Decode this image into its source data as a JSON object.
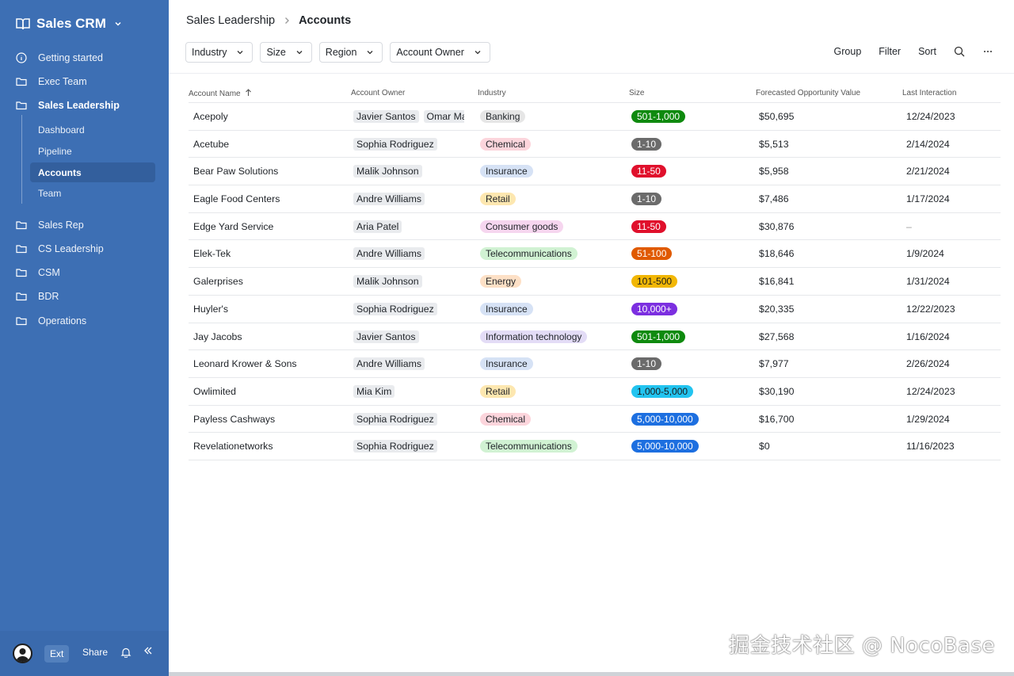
{
  "sidebar": {
    "app_title": "Sales CRM",
    "items": [
      {
        "label": "Getting started"
      },
      {
        "label": "Exec Team"
      },
      {
        "label": "Sales Leadership"
      },
      {
        "label": "Sales Rep"
      },
      {
        "label": "CS Leadership"
      },
      {
        "label": "CSM"
      },
      {
        "label": "BDR"
      },
      {
        "label": "Operations"
      }
    ],
    "sub_items": [
      {
        "label": "Dashboard"
      },
      {
        "label": "Pipeline"
      },
      {
        "label": "Accounts"
      },
      {
        "label": "Team"
      }
    ],
    "bottom": {
      "ext_label": "Ext",
      "share_label": "Share"
    }
  },
  "header": {
    "breadcrumb_parent": "Sales Leadership",
    "breadcrumb_current": "Accounts",
    "filters": [
      {
        "label": "Industry"
      },
      {
        "label": "Size"
      },
      {
        "label": "Region"
      },
      {
        "label": "Account Owner"
      }
    ],
    "toolbar": {
      "group": "Group",
      "filter": "Filter",
      "sort": "Sort"
    }
  },
  "table": {
    "columns": [
      "Account Name",
      "Account Owner",
      "Industry",
      "Size",
      "Forecasted Opportunity Value",
      "Last Interaction"
    ],
    "rows": [
      {
        "name": "Acepoly",
        "owners": [
          "Javier Santos",
          "Omar Mar"
        ],
        "industry": "Banking",
        "size": "501-1,000",
        "value": "$50,695",
        "last": "12/24/2023"
      },
      {
        "name": "Acetube",
        "owners": [
          "Sophia Rodriguez"
        ],
        "industry": "Chemical",
        "size": "1-10",
        "value": "$5,513",
        "last": "2/14/2024"
      },
      {
        "name": "Bear Paw Solutions",
        "owners": [
          "Malik Johnson"
        ],
        "industry": "Insurance",
        "size": "11-50",
        "value": "$5,958",
        "last": "2/21/2024"
      },
      {
        "name": "Eagle Food Centers",
        "owners": [
          "Andre Williams"
        ],
        "industry": "Retail",
        "size": "1-10",
        "value": "$7,486",
        "last": "1/17/2024"
      },
      {
        "name": "Edge Yard Service",
        "owners": [
          "Aria Patel"
        ],
        "industry": "Consumer goods",
        "size": "11-50",
        "value": "$30,876",
        "last": "–"
      },
      {
        "name": "Elek-Tek",
        "owners": [
          "Andre Williams"
        ],
        "industry": "Telecommunications",
        "size": "51-100",
        "value": "$18,646",
        "last": "1/9/2024"
      },
      {
        "name": "Galerprises",
        "owners": [
          "Malik Johnson"
        ],
        "industry": "Energy",
        "size": "101-500",
        "value": "$16,841",
        "last": "1/31/2024"
      },
      {
        "name": "Huyler's",
        "owners": [
          "Sophia Rodriguez"
        ],
        "industry": "Insurance",
        "size": "10,000+",
        "value": "$20,335",
        "last": "12/22/2023"
      },
      {
        "name": "Jay Jacobs",
        "owners": [
          "Javier Santos"
        ],
        "industry": "Information technology",
        "size": "501-1,000",
        "value": "$27,568",
        "last": "1/16/2024"
      },
      {
        "name": "Leonard Krower & Sons",
        "owners": [
          "Andre Williams"
        ],
        "industry": "Insurance",
        "size": "1-10",
        "value": "$7,977",
        "last": "2/26/2024"
      },
      {
        "name": "Owlimited",
        "owners": [
          "Mia Kim"
        ],
        "industry": "Retail",
        "size": "1,000-5,000",
        "value": "$30,190",
        "last": "12/24/2023"
      },
      {
        "name": "Payless Cashways",
        "owners": [
          "Sophia Rodriguez"
        ],
        "industry": "Chemical",
        "size": "5,000-10,000",
        "value": "$16,700",
        "last": "1/29/2024"
      },
      {
        "name": "Revelationetworks",
        "owners": [
          "Sophia Rodriguez"
        ],
        "industry": "Telecommunications",
        "size": "5,000-10,000",
        "value": "$0",
        "last": "11/16/2023"
      }
    ]
  },
  "colors": {
    "sidebar_bg": "#3d6fb4",
    "industry": {
      "Banking": "#e6e6e6",
      "Chemical": "#fcd5dc",
      "Insurance": "#d6e2f5",
      "Retail": "#fde7b0",
      "Consumer goods": "#f6d6ef",
      "Telecommunications": "#d1f2d3",
      "Energy": "#fde0c6",
      "Information technology": "#e3dcf6"
    },
    "size": {
      "501-1,000": "#0f8a0f",
      "1-10": "#6b6b6b",
      "11-50": "#e0102c",
      "51-100": "#e05a00",
      "101-500": "#f2b705",
      "10,000+": "#7c2fe0",
      "1,000-5,000": "#22c4f0",
      "5,000-10,000": "#1d6fe0"
    }
  },
  "watermark": "掘金技术社区 @ NocoBase"
}
